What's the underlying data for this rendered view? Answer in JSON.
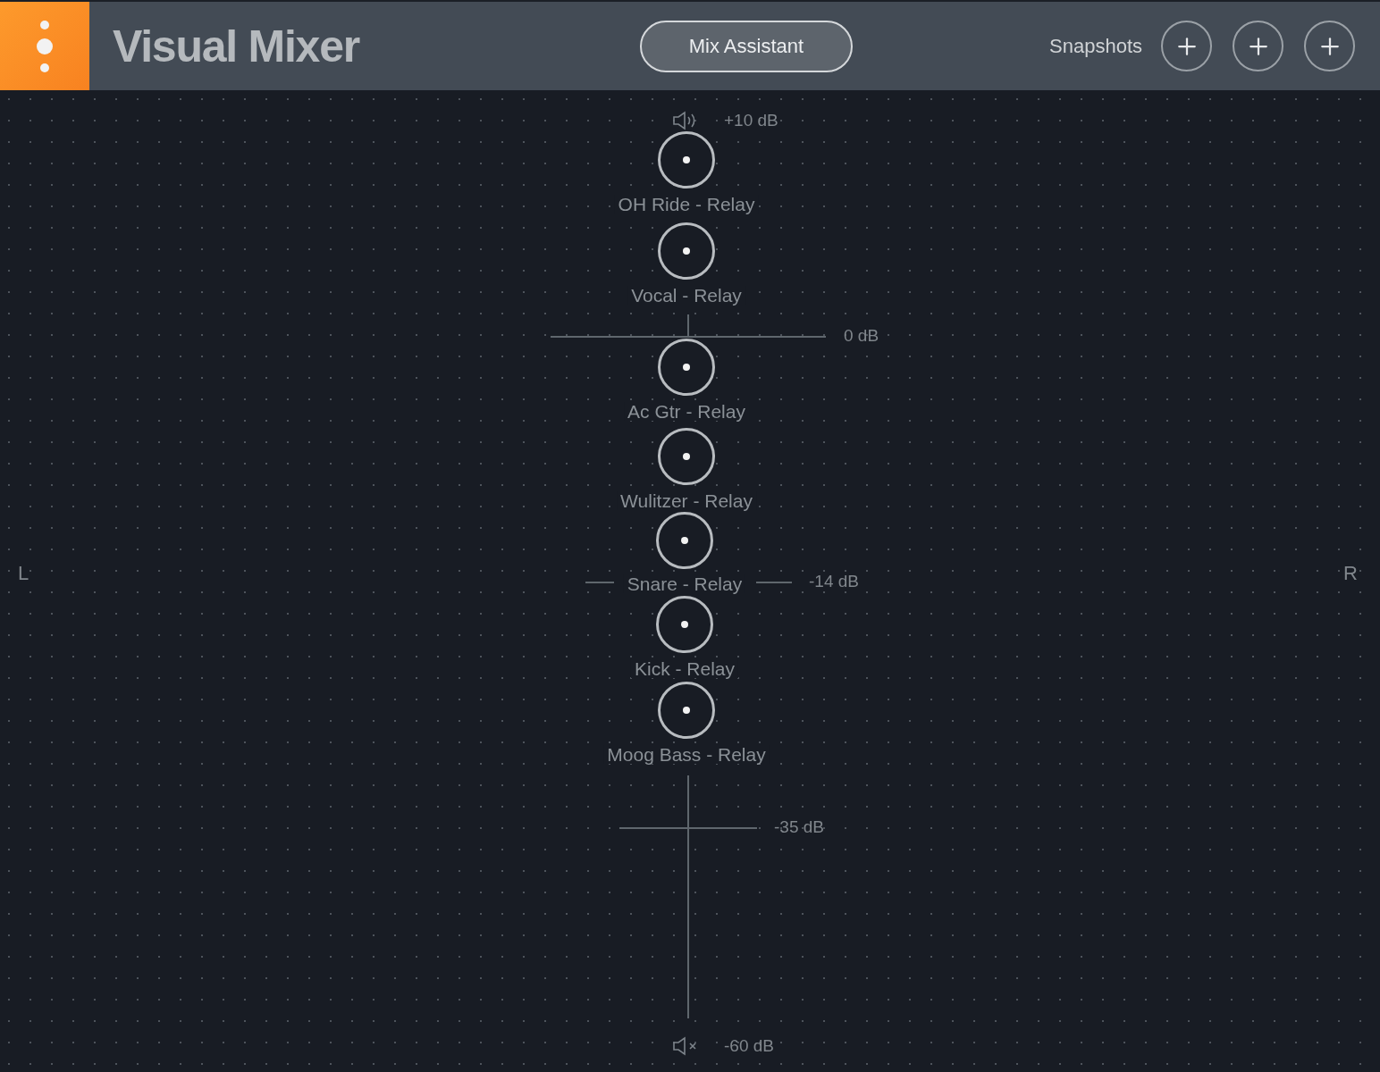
{
  "header": {
    "title": "Visual Mixer",
    "mix_assistant": "Mix Assistant",
    "snapshots": {
      "label": "Snapshots",
      "buttons": [
        {
          "kind": "add"
        },
        {
          "kind": "add"
        },
        {
          "kind": "add"
        }
      ]
    }
  },
  "pan_labels": {
    "left": "L",
    "right": "R"
  },
  "scale": [
    {
      "kind": "loud",
      "label": "+10 dB"
    },
    {
      "kind": "cross",
      "label": "0 dB"
    },
    {
      "kind": "dash",
      "label": "-14 dB"
    },
    {
      "kind": "cross",
      "label": "-35 dB"
    },
    {
      "kind": "mute",
      "label": "-60 dB"
    }
  ],
  "channels": [
    {
      "name": "OH Ride - Relay"
    },
    {
      "name": "Vocal - Relay"
    },
    {
      "name": "Ac Gtr - Relay"
    },
    {
      "name": "Wulitzer - Relay"
    },
    {
      "name": "Snare - Relay"
    },
    {
      "name": "Kick - Relay"
    },
    {
      "name": "Moog Bass - Relay"
    }
  ]
}
